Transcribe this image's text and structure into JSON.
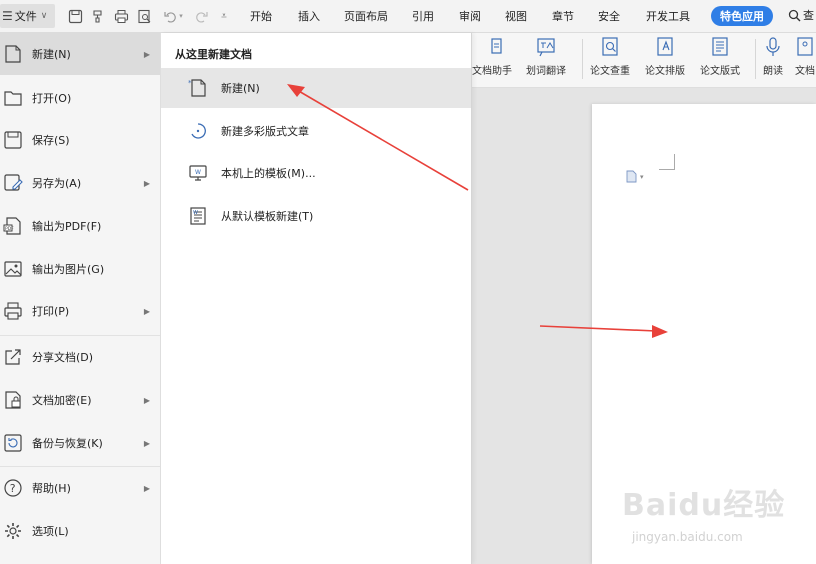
{
  "menubar": {
    "file_label": "文件",
    "items": [
      "开始",
      "插入",
      "页面布局",
      "引用",
      "审阅",
      "视图",
      "章节",
      "安全",
      "开发工具"
    ],
    "special_label": "特色应用",
    "search_label": "查"
  },
  "toolbar": {
    "tools": [
      "文档助手",
      "划词翻译",
      "论文查重",
      "论文排版",
      "论文版式",
      "朗读",
      "文档"
    ]
  },
  "leftmenu": {
    "items": [
      {
        "label": "新建(N)",
        "icon": "new-doc-icon",
        "has_arrow": true
      },
      {
        "label": "打开(O)",
        "icon": "folder-icon",
        "has_arrow": false
      },
      {
        "label": "保存(S)",
        "icon": "save-icon",
        "has_arrow": false
      },
      {
        "label": "另存为(A)",
        "icon": "save-as-icon",
        "has_arrow": true
      },
      {
        "label": "输出为PDF(F)",
        "icon": "pdf-icon",
        "has_arrow": false
      },
      {
        "label": "输出为图片(G)",
        "icon": "image-icon",
        "has_arrow": false
      },
      {
        "label": "打印(P)",
        "icon": "print-icon",
        "has_arrow": true
      },
      {
        "label": "分享文档(D)",
        "icon": "share-icon",
        "has_arrow": false
      },
      {
        "label": "文档加密(E)",
        "icon": "lock-doc-icon",
        "has_arrow": true
      },
      {
        "label": "备份与恢复(K)",
        "icon": "backup-icon",
        "has_arrow": true
      },
      {
        "label": "帮助(H)",
        "icon": "help-icon",
        "has_arrow": true
      },
      {
        "label": "选项(L)",
        "icon": "gear-icon",
        "has_arrow": false
      }
    ]
  },
  "submenu": {
    "title": "从这里新建文档",
    "items": [
      {
        "label": "新建(N)",
        "icon": "new-doc-icon"
      },
      {
        "label": "新建多彩版式文章",
        "icon": "colorful-layout-icon"
      },
      {
        "label": "本机上的模板(M)...",
        "icon": "local-template-icon"
      },
      {
        "label": "从默认模板新建(T)",
        "icon": "default-template-icon"
      }
    ]
  },
  "watermark": {
    "text": "Baidu经验",
    "url_text": "jingyan.baidu.com"
  },
  "colors": {
    "accent": "#2f7ee6",
    "arrow": "#e8413a"
  }
}
